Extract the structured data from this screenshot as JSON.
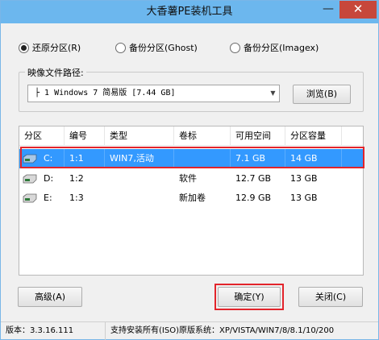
{
  "window": {
    "title": "大香薯PE装机工具",
    "minimize_icon": "minimize-icon",
    "close_icon": "close-icon"
  },
  "modes": [
    {
      "label": "还原分区(R)",
      "checked": true
    },
    {
      "label": "备份分区(Ghost)",
      "checked": false
    },
    {
      "label": "备份分区(Imagex)",
      "checked": false
    }
  ],
  "image": {
    "group_label": "映像文件路径:",
    "selected": "├ 1 Windows 7 简易版 [7.44 GB]",
    "browse_label": "浏览(B)"
  },
  "table": {
    "columns": [
      "分区",
      "编号",
      "类型",
      "卷标",
      "可用空间",
      "分区容量"
    ],
    "rows": [
      {
        "partition": "C:",
        "number": "1:1",
        "type": "WIN7,活动",
        "label": "",
        "free": "7.1 GB",
        "size": "14 GB",
        "selected": true
      },
      {
        "partition": "D:",
        "number": "1:2",
        "type": "",
        "label": "软件",
        "free": "12.7 GB",
        "size": "13 GB",
        "selected": false
      },
      {
        "partition": "E:",
        "number": "1:3",
        "type": "",
        "label": "新加卷",
        "free": "12.9 GB",
        "size": "13 GB",
        "selected": false
      }
    ]
  },
  "buttons": {
    "advanced": "高级(A)",
    "ok": "确定(Y)",
    "close": "关闭(C)"
  },
  "status": {
    "version": "版本：3.3.16.111",
    "message": "支持安装所有(ISO)原版系统：XP/VISTA/WIN7/8/8.1/10/200"
  },
  "colors": {
    "titlebar": "#6cb7ee",
    "selection": "#3399ff",
    "highlight": "#e2242b"
  }
}
